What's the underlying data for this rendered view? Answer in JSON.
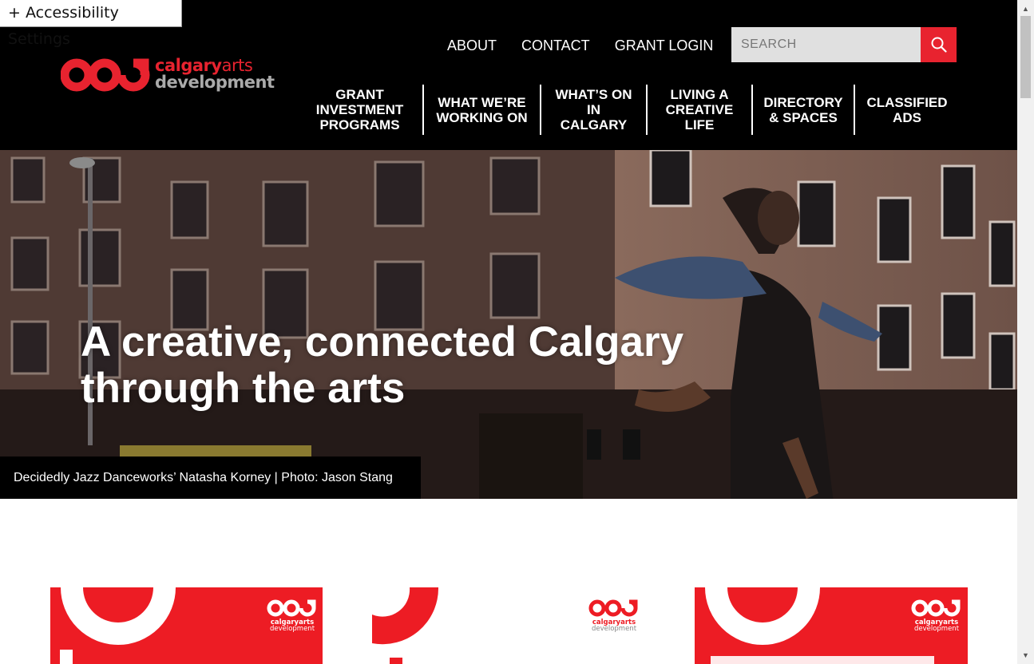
{
  "accessibility": {
    "label": "+ Accessibility Settings"
  },
  "logo": {
    "word1": "calgary",
    "word2": "arts",
    "word3": "development"
  },
  "top_links": [
    "ABOUT",
    "CONTACT",
    "GRANT LOGIN"
  ],
  "search": {
    "placeholder": "SEARCH"
  },
  "main_nav": [
    {
      "line1": "GRANT",
      "line2": "INVESTMENT",
      "line3": "PROGRAMS"
    },
    {
      "line1": "WHAT WE’RE",
      "line2": "WORKING ON",
      "line3": ""
    },
    {
      "line1": "WHAT’S ON",
      "line2": "IN",
      "line3": "CALGARY"
    },
    {
      "line1": "LIVING A",
      "line2": "CREATIVE",
      "line3": "LIFE"
    },
    {
      "line1": "DIRECTORY",
      "line2": "& SPACES",
      "line3": ""
    },
    {
      "line1": "CLASSIFIED",
      "line2": "ADS",
      "line3": ""
    }
  ],
  "hero": {
    "title_line1": "A creative, connected Calgary",
    "title_line2": "through the arts",
    "caption": "Decidedly Jazz Danceworks’ Natasha Korney | Photo: Jason Stang"
  },
  "cards": {
    "logo_word1": "calgary",
    "logo_word2": "arts",
    "logo_word3": "development"
  },
  "colors": {
    "brand_red": "#e8232f",
    "header_bg": "#000000"
  }
}
